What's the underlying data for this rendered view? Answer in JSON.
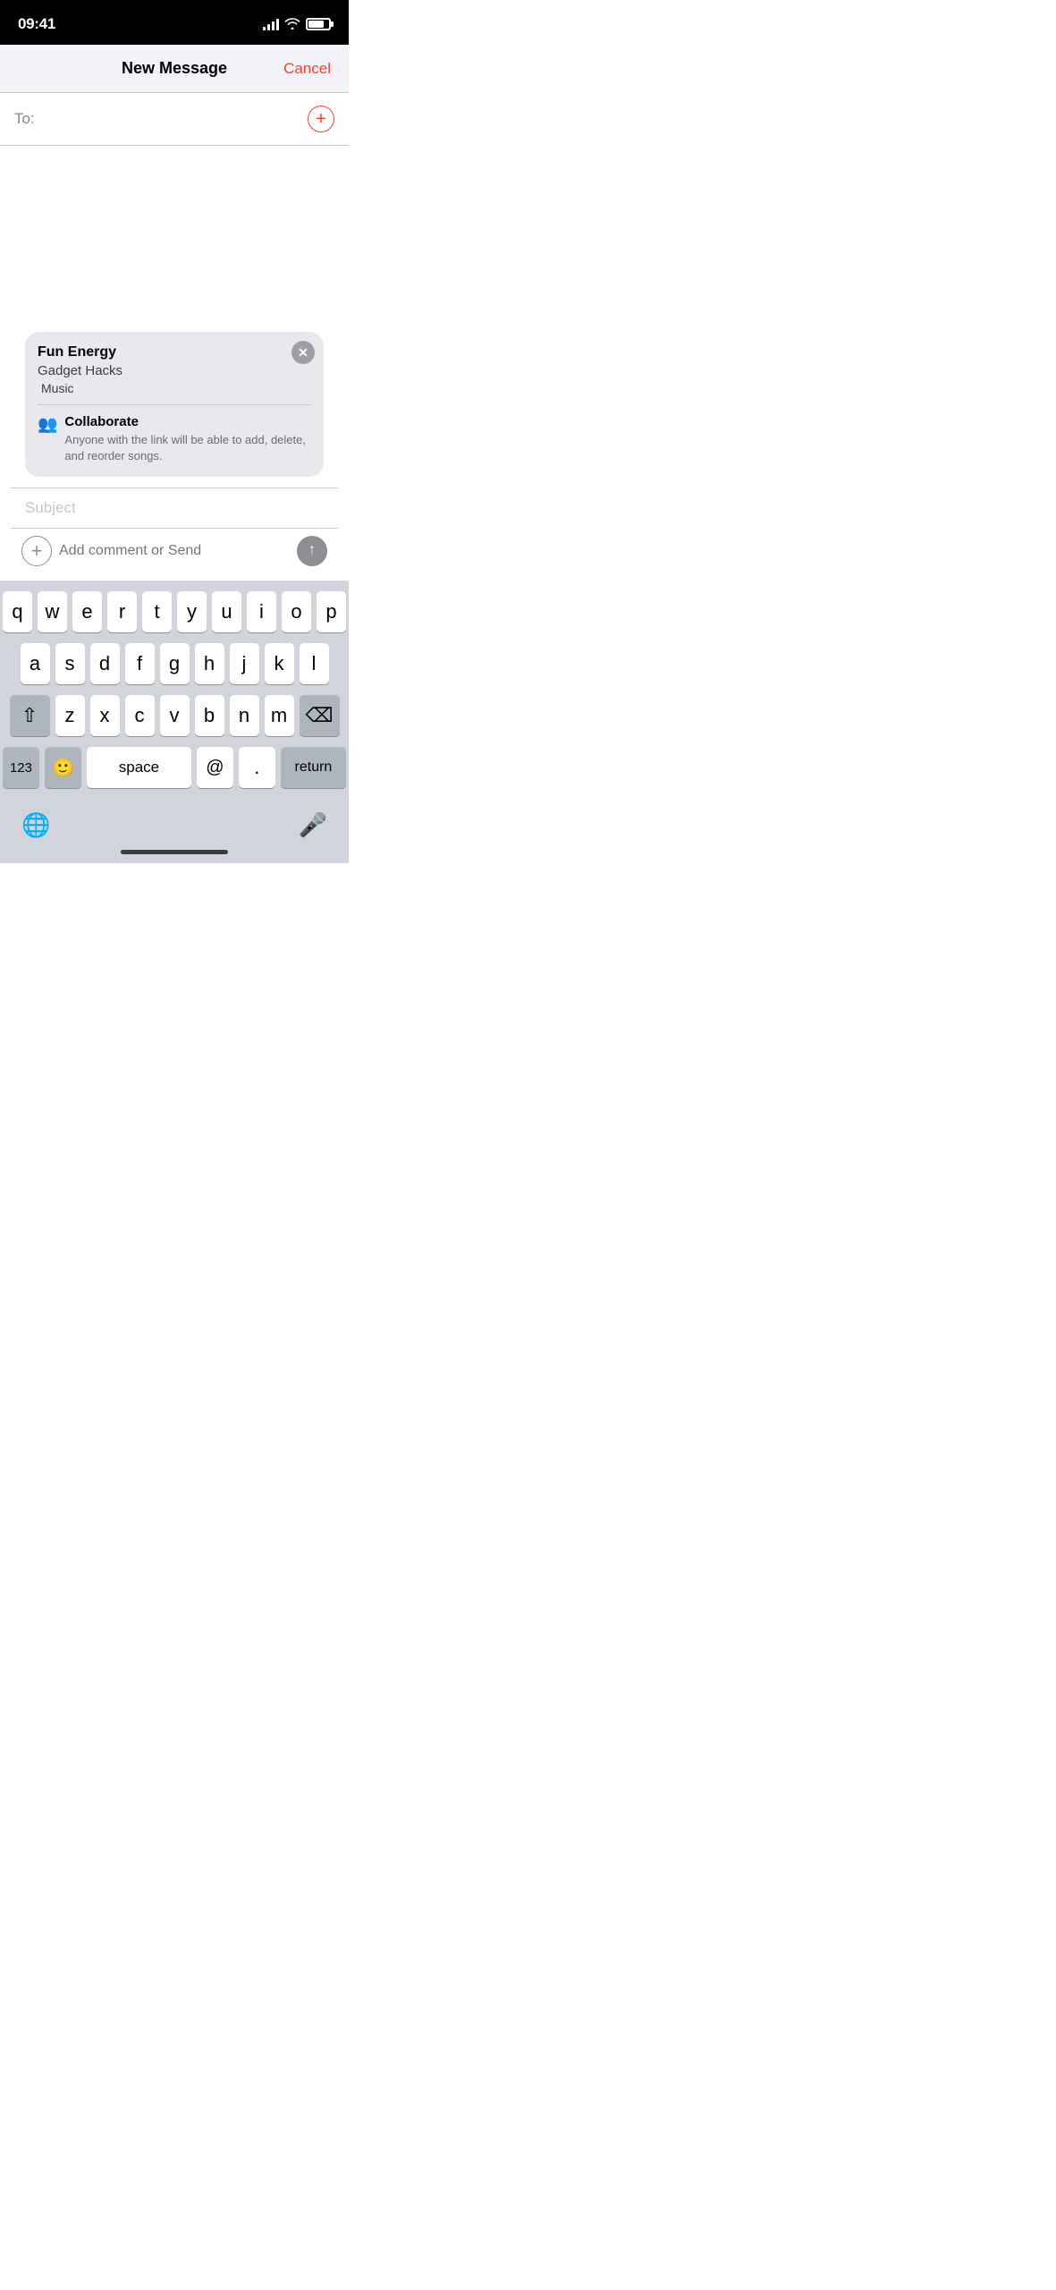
{
  "statusBar": {
    "time": "09:41",
    "signal": [
      2,
      4,
      6,
      9,
      11
    ],
    "battery": 75
  },
  "header": {
    "title": "New Message",
    "cancelLabel": "Cancel"
  },
  "toField": {
    "label": "To:",
    "placeholder": ""
  },
  "attachmentCard": {
    "title": "Fun Energy",
    "subtitle": "Gadget Hacks",
    "service": "Music",
    "actionTitle": "Collaborate",
    "actionDescription": "Anyone with the link will be able to add, delete, and reorder songs."
  },
  "subjectField": {
    "placeholder": "Subject"
  },
  "messageInput": {
    "placeholder": "Add comment or Send"
  },
  "keyboard": {
    "row1": [
      "q",
      "w",
      "e",
      "r",
      "t",
      "y",
      "u",
      "i",
      "o",
      "p"
    ],
    "row2": [
      "a",
      "s",
      "d",
      "f",
      "g",
      "h",
      "j",
      "k",
      "l"
    ],
    "row3": [
      "z",
      "x",
      "c",
      "v",
      "b",
      "n",
      "m"
    ],
    "shiftLabel": "⇧",
    "backspaceLabel": "⌫",
    "numbersLabel": "123",
    "emojiLabel": "😊",
    "spaceLabel": "space",
    "atLabel": "@",
    "periodLabel": ".",
    "returnLabel": "return"
  }
}
